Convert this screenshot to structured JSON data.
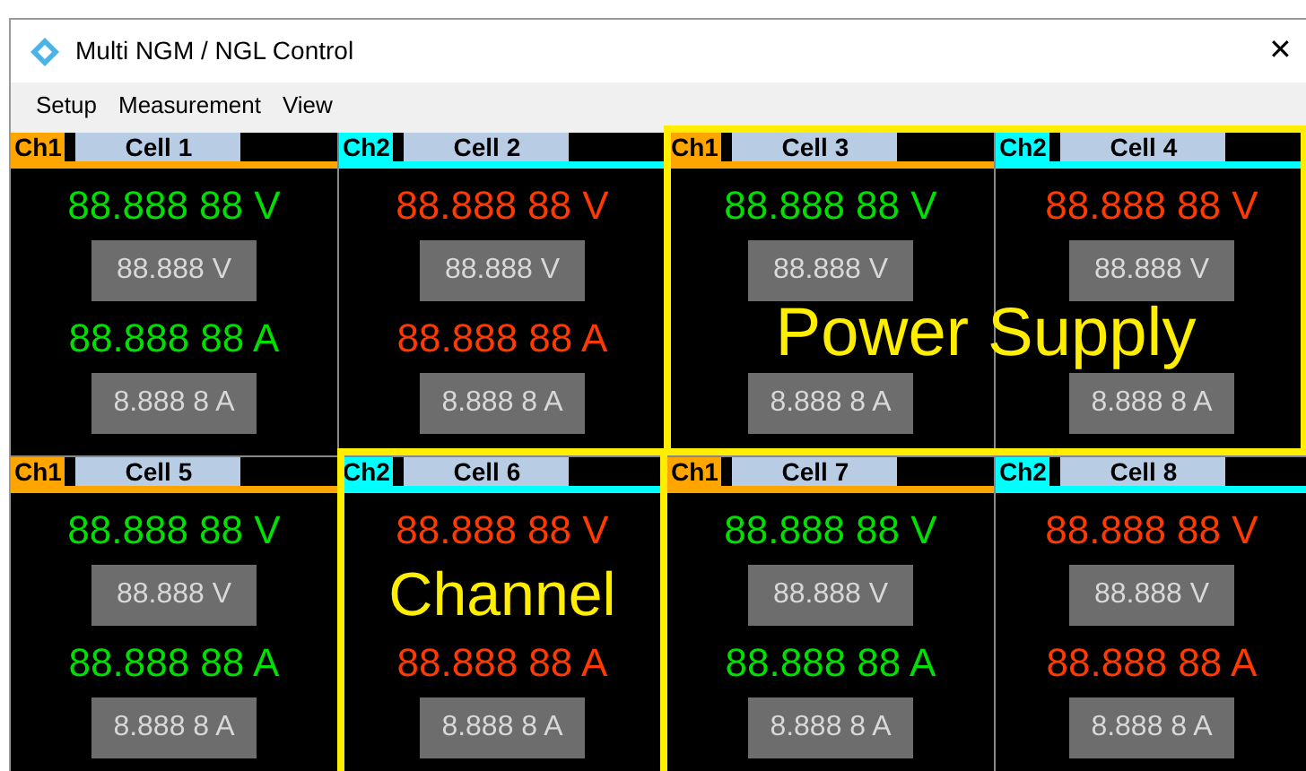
{
  "window": {
    "title": "Multi NGM / NGL Control",
    "close": "✕"
  },
  "menu": [
    "Setup",
    "Measurement",
    "View"
  ],
  "cells": [
    {
      "channel": {
        "label": "Ch1",
        "color": "#ffa500"
      },
      "name": "Cell 1",
      "color": "#00e000",
      "voltage": "88.888 88 V",
      "voltage_set": "88.888 V",
      "current": "88.888 88 A",
      "current_set": "8.888 8 A"
    },
    {
      "channel": {
        "label": "Ch2",
        "color": "#00ffff"
      },
      "name": "Cell 2",
      "color": "#ff3a00",
      "voltage": "88.888 88 V",
      "voltage_set": "88.888 V",
      "current": "88.888 88 A",
      "current_set": "8.888 8 A"
    },
    {
      "channel": {
        "label": "Ch1",
        "color": "#ffa500"
      },
      "name": "Cell 3",
      "color": "#00e000",
      "voltage": "88.888 88 V",
      "voltage_set": "88.888 V",
      "current_set": "8.888 8 A"
    },
    {
      "channel": {
        "label": "Ch2",
        "color": "#00ffff"
      },
      "name": "Cell 4",
      "color": "#ff3a00",
      "voltage": "88.888 88 V",
      "voltage_set": "88.888 V",
      "current_set": "8.888 8 A"
    },
    {
      "channel": {
        "label": "Ch1",
        "color": "#ffa500"
      },
      "name": "Cell 5",
      "color": "#00e000",
      "voltage": "88.888 88 V",
      "voltage_set": "88.888 V",
      "current": "88.888 88 A",
      "current_set": "8.888 8 A"
    },
    {
      "channel": {
        "label": "Ch2",
        "color": "#00ffff"
      },
      "name": "Cell 6",
      "color": "#ff3a00",
      "voltage": "88.888 88 V",
      "current": "88.888 88 A",
      "current_set": "8.888 8 A"
    },
    {
      "channel": {
        "label": "Ch1",
        "color": "#ffa500"
      },
      "name": "Cell 7",
      "color": "#00e000",
      "voltage": "88.888 88 V",
      "voltage_set": "88.888 V",
      "current": "88.888 88 A",
      "current_set": "8.888 8 A"
    },
    {
      "channel": {
        "label": "Ch2",
        "color": "#00ffff"
      },
      "name": "Cell 8",
      "color": "#ff3a00",
      "voltage": "88.888 88 V",
      "voltage_set": "88.888 V",
      "current": "88.888 88 A",
      "current_set": "8.888 8 A"
    }
  ],
  "annotations": [
    {
      "kind": "group",
      "label": "Power Supply"
    },
    {
      "kind": "single",
      "label": "Channel"
    }
  ]
}
